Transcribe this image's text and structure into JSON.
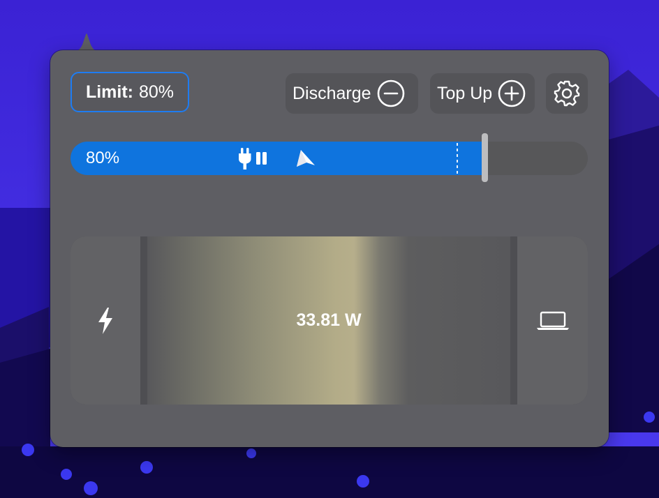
{
  "header": {
    "limit_label": "Limit:",
    "limit_value": "80%",
    "discharge_label": "Discharge",
    "topup_label": "Top Up"
  },
  "charge_bar": {
    "label": "80%",
    "level": 0.8,
    "limit": 0.8
  },
  "power_flow": {
    "watts": "33.81 W"
  },
  "icons": {
    "discharge": "minus-circle-icon",
    "topup": "plus-circle-icon",
    "settings": "gear-icon",
    "plug": "plug-icon",
    "pause": "pause-icon",
    "arrow": "location-arrow-icon",
    "source": "bolt-icon",
    "device": "laptop-icon"
  },
  "colors": {
    "accent": "#0f74de",
    "panel": "#5e5e63",
    "wallpaper": "#3a26d6"
  }
}
